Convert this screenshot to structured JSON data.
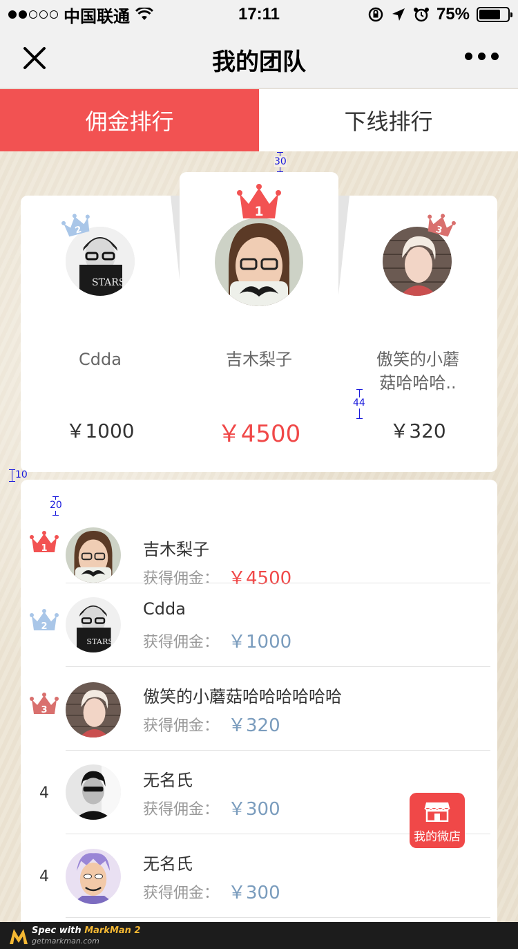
{
  "status_bar": {
    "carrier": "中国联通",
    "time": "17:11",
    "battery": "75%"
  },
  "nav": {
    "title": "我的团队",
    "close_icon": "close-icon",
    "more_icon": "more-icon"
  },
  "tabs": [
    {
      "label": "佣金排行",
      "active": true
    },
    {
      "label": "下线排行",
      "active": false
    }
  ],
  "podium": {
    "first": {
      "rank": "1",
      "name": "吉木梨子",
      "amount": "￥4500"
    },
    "second": {
      "rank": "2",
      "name": "Cdda",
      "amount": "￥1000"
    },
    "third": {
      "rank": "3",
      "name_line1": "傲笑的小蘑",
      "name_line2": "菇哈哈哈..",
      "amount": "￥320"
    }
  },
  "list": {
    "commission_label": "获得佣金：",
    "rows": [
      {
        "rank": "1",
        "name": "吉木梨子",
        "amount": "￥4500"
      },
      {
        "rank": "2",
        "name": "Cdda",
        "amount": "￥1000"
      },
      {
        "rank": "3",
        "name": "傲笑的小蘑菇哈哈哈哈哈哈",
        "amount": "￥320"
      },
      {
        "rank": "4",
        "name": "无名氏",
        "amount": "￥300"
      },
      {
        "rank": "4",
        "name": "无名氏",
        "amount": "￥300"
      }
    ]
  },
  "shop_button": {
    "label": "我的微店",
    "icon": "storefront-icon"
  },
  "spec_marks": {
    "a": "30",
    "b": "44",
    "c": "10",
    "d": "20"
  },
  "footer": {
    "spec_with": "Spec with ",
    "brand": "MarkMan 2",
    "site": "getmarkman.com"
  },
  "colors": {
    "accent": "#f25252",
    "blue_amount": "#7a9cbd",
    "silver_crown": "#a9c6e8",
    "bronze_crown": "#d9706e"
  }
}
